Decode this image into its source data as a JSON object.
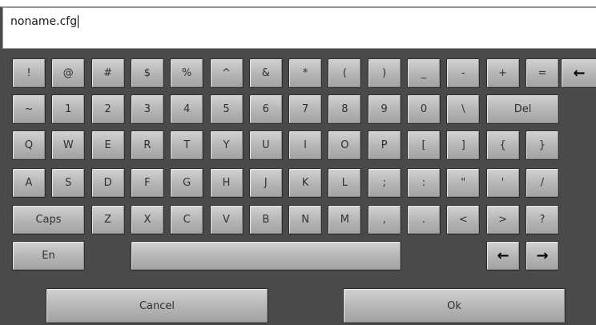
{
  "input": {
    "value": "noname.cfg"
  },
  "keys": {
    "row1": [
      "!",
      "@",
      "#",
      "$",
      "%",
      "^",
      "&",
      "*",
      "(",
      ")",
      "_",
      "-",
      "+",
      "="
    ],
    "row2": [
      "~",
      "1",
      "2",
      "3",
      "4",
      "5",
      "6",
      "7",
      "8",
      "9",
      "0",
      "\\"
    ],
    "row3": [
      "Q",
      "W",
      "E",
      "R",
      "T",
      "Y",
      "U",
      "I",
      "O",
      "P",
      "[",
      "]",
      "{",
      "}"
    ],
    "row4": [
      "A",
      "S",
      "D",
      "F",
      "G",
      "H",
      "J",
      "K",
      "L",
      ";",
      ":",
      "\"",
      "'",
      "/"
    ],
    "row5": [
      "Z",
      "X",
      "C",
      "V",
      "B",
      "N",
      "M",
      ",",
      ".",
      "<",
      ">",
      "?"
    ],
    "del": "Del",
    "caps": "Caps",
    "lang": "En",
    "cancel": "Cancel",
    "ok": "Ok",
    "backspace_glyph": "←",
    "left_glyph": "←",
    "right_glyph": "→"
  },
  "icons": {
    "backspace": "backspace-arrow-icon",
    "left": "left-arrow-icon",
    "right": "right-arrow-icon"
  }
}
